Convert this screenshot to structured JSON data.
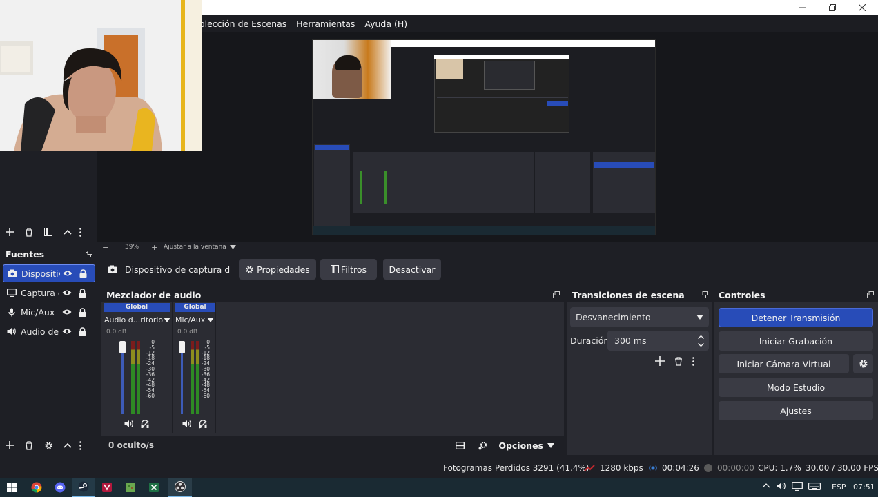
{
  "menubar": {
    "items": [
      "olección de Escenas",
      "Herramientas",
      "Ayuda (H)"
    ]
  },
  "preview": {
    "zoom": "39%",
    "fit_label": "Ajustar a la ventana",
    "minus": "−",
    "plus": "+"
  },
  "sources": {
    "title": "Fuentes",
    "items": [
      {
        "name": "Dispositiv",
        "icon": "camera-icon",
        "selected": true
      },
      {
        "name": "Captura d",
        "icon": "monitor-icon",
        "selected": false
      },
      {
        "name": "Mic/Aux",
        "icon": "microphone-icon",
        "selected": false
      },
      {
        "name": "Audio del",
        "icon": "speaker-icon",
        "selected": false
      }
    ]
  },
  "context": {
    "source_name": "Dispositivo de captura de v",
    "properties": "Propiedades",
    "filters": "Filtros",
    "deactivate": "Desactivar"
  },
  "mixer": {
    "title": "Mezclador de audio",
    "channels": [
      {
        "tag": "Global",
        "name": "Audio d...ritorio",
        "db": "0.0 dB",
        "level": 0.0
      },
      {
        "tag": "Global",
        "name": "Mic/Aux",
        "db": "0.0 dB",
        "level": 0.0
      }
    ],
    "scale": [
      "0",
      "-5",
      "-12",
      "-18",
      "-24",
      "-30",
      "-36",
      "-42",
      "-48",
      "-54",
      "-60"
    ],
    "hidden_count": "0 oculto/s",
    "options": "Opciones"
  },
  "transitions": {
    "title": "Transiciones de escena",
    "selected": "Desvanecimiento",
    "duration_label": "Duración",
    "duration_value": "300 ms"
  },
  "controls": {
    "title": "Controles",
    "stop_stream": "Detener Transmisión",
    "start_recording": "Iniciar Grabación",
    "virtual_camera": "Iniciar Cámara Virtual",
    "studio_mode": "Modo Estudio",
    "settings": "Ajustes"
  },
  "status": {
    "dropped": "Fotogramas Perdidos 3291 (41.4%)",
    "bitrate": "1280 kbps",
    "stream_time": "00:04:26",
    "rec_time": "00:00:00",
    "cpu": "CPU: 1.7%",
    "fps": "30.00 / 30.00 FPS"
  },
  "taskbar": {
    "lang": "ESP",
    "time": "07:51"
  },
  "colors": {
    "accent": "#284cb8",
    "panel": "#2b2c33",
    "background": "#1e1f25",
    "button": "#3a3b44",
    "meter_green": "#3a8f2a",
    "meter_yellow": "#9b9b20",
    "meter_red": "#8f2020"
  }
}
